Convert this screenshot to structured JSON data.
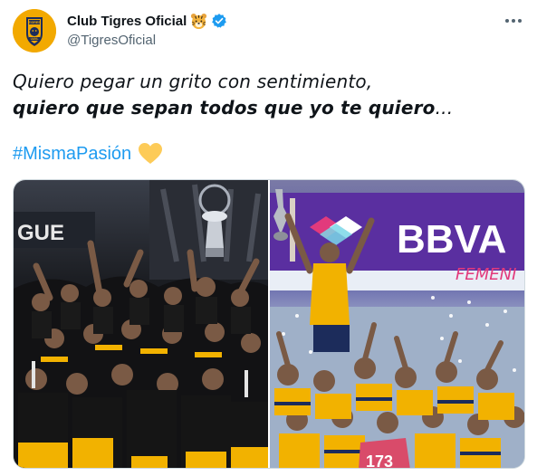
{
  "author": {
    "display_name": "Club Tigres Oficial",
    "handle": "@TigresOficial",
    "avatar_icon": "tigres-uanl-crest-icon",
    "verified_icon": "verified-badge-icon",
    "emoji_icon": "tiger-face-icon"
  },
  "tweet": {
    "line1": "Quiero pegar un grito con sentimiento,",
    "line2_bold": "quiero que sepan todos que yo te quiero",
    "line2_tail": "...",
    "hashtag": "#MismaPasión",
    "hashtag_emoji": "yellow-heart-icon"
  },
  "avatar_text": {
    "top": "TIGRES",
    "bottom": "UANL"
  },
  "media": {
    "photo_left": {
      "description_icon": "mens-team-celebration-photo",
      "banner_text": "GUE"
    },
    "photo_right": {
      "description_icon": "womens-team-celebration-photo",
      "sponsor_text": "BBVA",
      "sponsor_sub": "FEMENI",
      "shirt_number": "173"
    }
  },
  "colors": {
    "link": "#1d9bf0",
    "text": "#0f1419",
    "secondary": "#536471",
    "tigres_gold": "#f2a900",
    "tigres_navy": "#1c2c5b"
  }
}
